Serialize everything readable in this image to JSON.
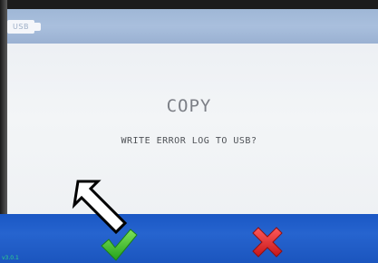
{
  "header": {
    "usb_badge": "USB",
    "icon": "usb-drive-icon"
  },
  "dialog": {
    "title": "COPY",
    "message": "WRITE ERROR LOG TO USB?"
  },
  "footer": {
    "confirm_icon": "green-checkmark-icon",
    "cancel_icon": "red-x-icon",
    "corner_text": "v3.0.1"
  },
  "colors": {
    "header": "#a9bfdd",
    "footer": "#2664cf",
    "confirm": "#3fbf2a",
    "cancel": "#e3262b",
    "title": "#7c7f86"
  }
}
